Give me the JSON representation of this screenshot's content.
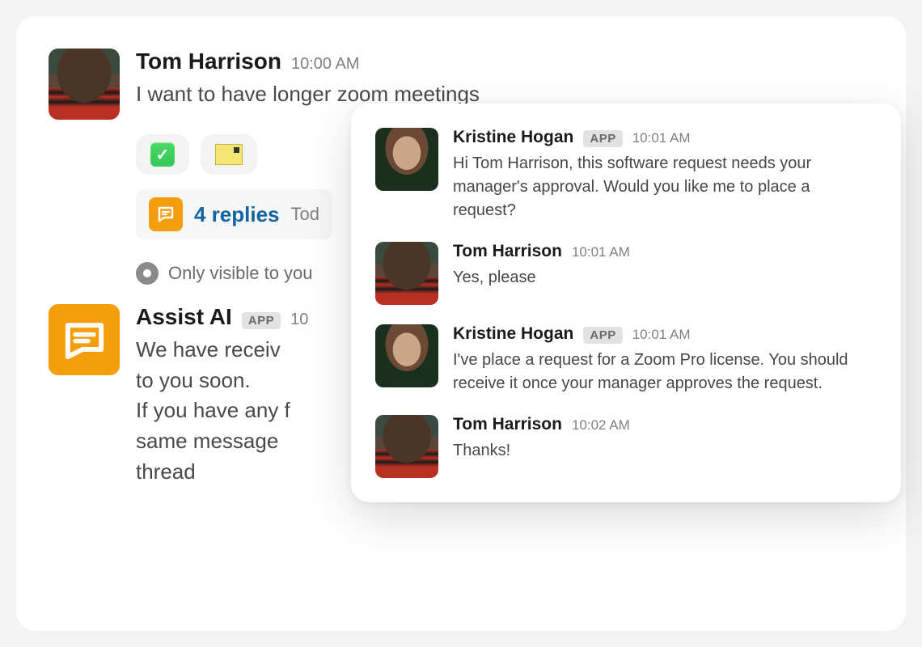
{
  "main": {
    "message": {
      "user": "Tom Harrison",
      "time": "10:00 AM",
      "text": "I want to have longer zoom meetings"
    },
    "reactions": {
      "check": "checkmark-emoji",
      "ticket": "ticket-emoji"
    },
    "thread": {
      "replies_label": "4 replies",
      "time_label": "Tod"
    },
    "visibility_label": "Only visible to you",
    "assist": {
      "user": "Assist AI",
      "badge": "APP",
      "time": "10",
      "line1": "We have receiv",
      "line2": "to you soon.",
      "line3": "If you have any f",
      "line4": "same message",
      "line5": "thread"
    }
  },
  "overlay": {
    "messages": [
      {
        "user": "Kristine Hogan",
        "badge": "APP",
        "time": "10:01 AM",
        "text": "Hi Tom Harrison, this software request needs your manager's approval. Would you like me to place a request?"
      },
      {
        "user": "Tom Harrison",
        "badge": "",
        "time": "10:01 AM",
        "text": "Yes, please"
      },
      {
        "user": "Kristine Hogan",
        "badge": "APP",
        "time": "10:01 AM",
        "text": "I've place a request for a Zoom Pro license. You should receive it once your manager approves the request."
      },
      {
        "user": "Tom Harrison",
        "badge": "",
        "time": "10:02 AM",
        "text": "Thanks!"
      }
    ]
  }
}
